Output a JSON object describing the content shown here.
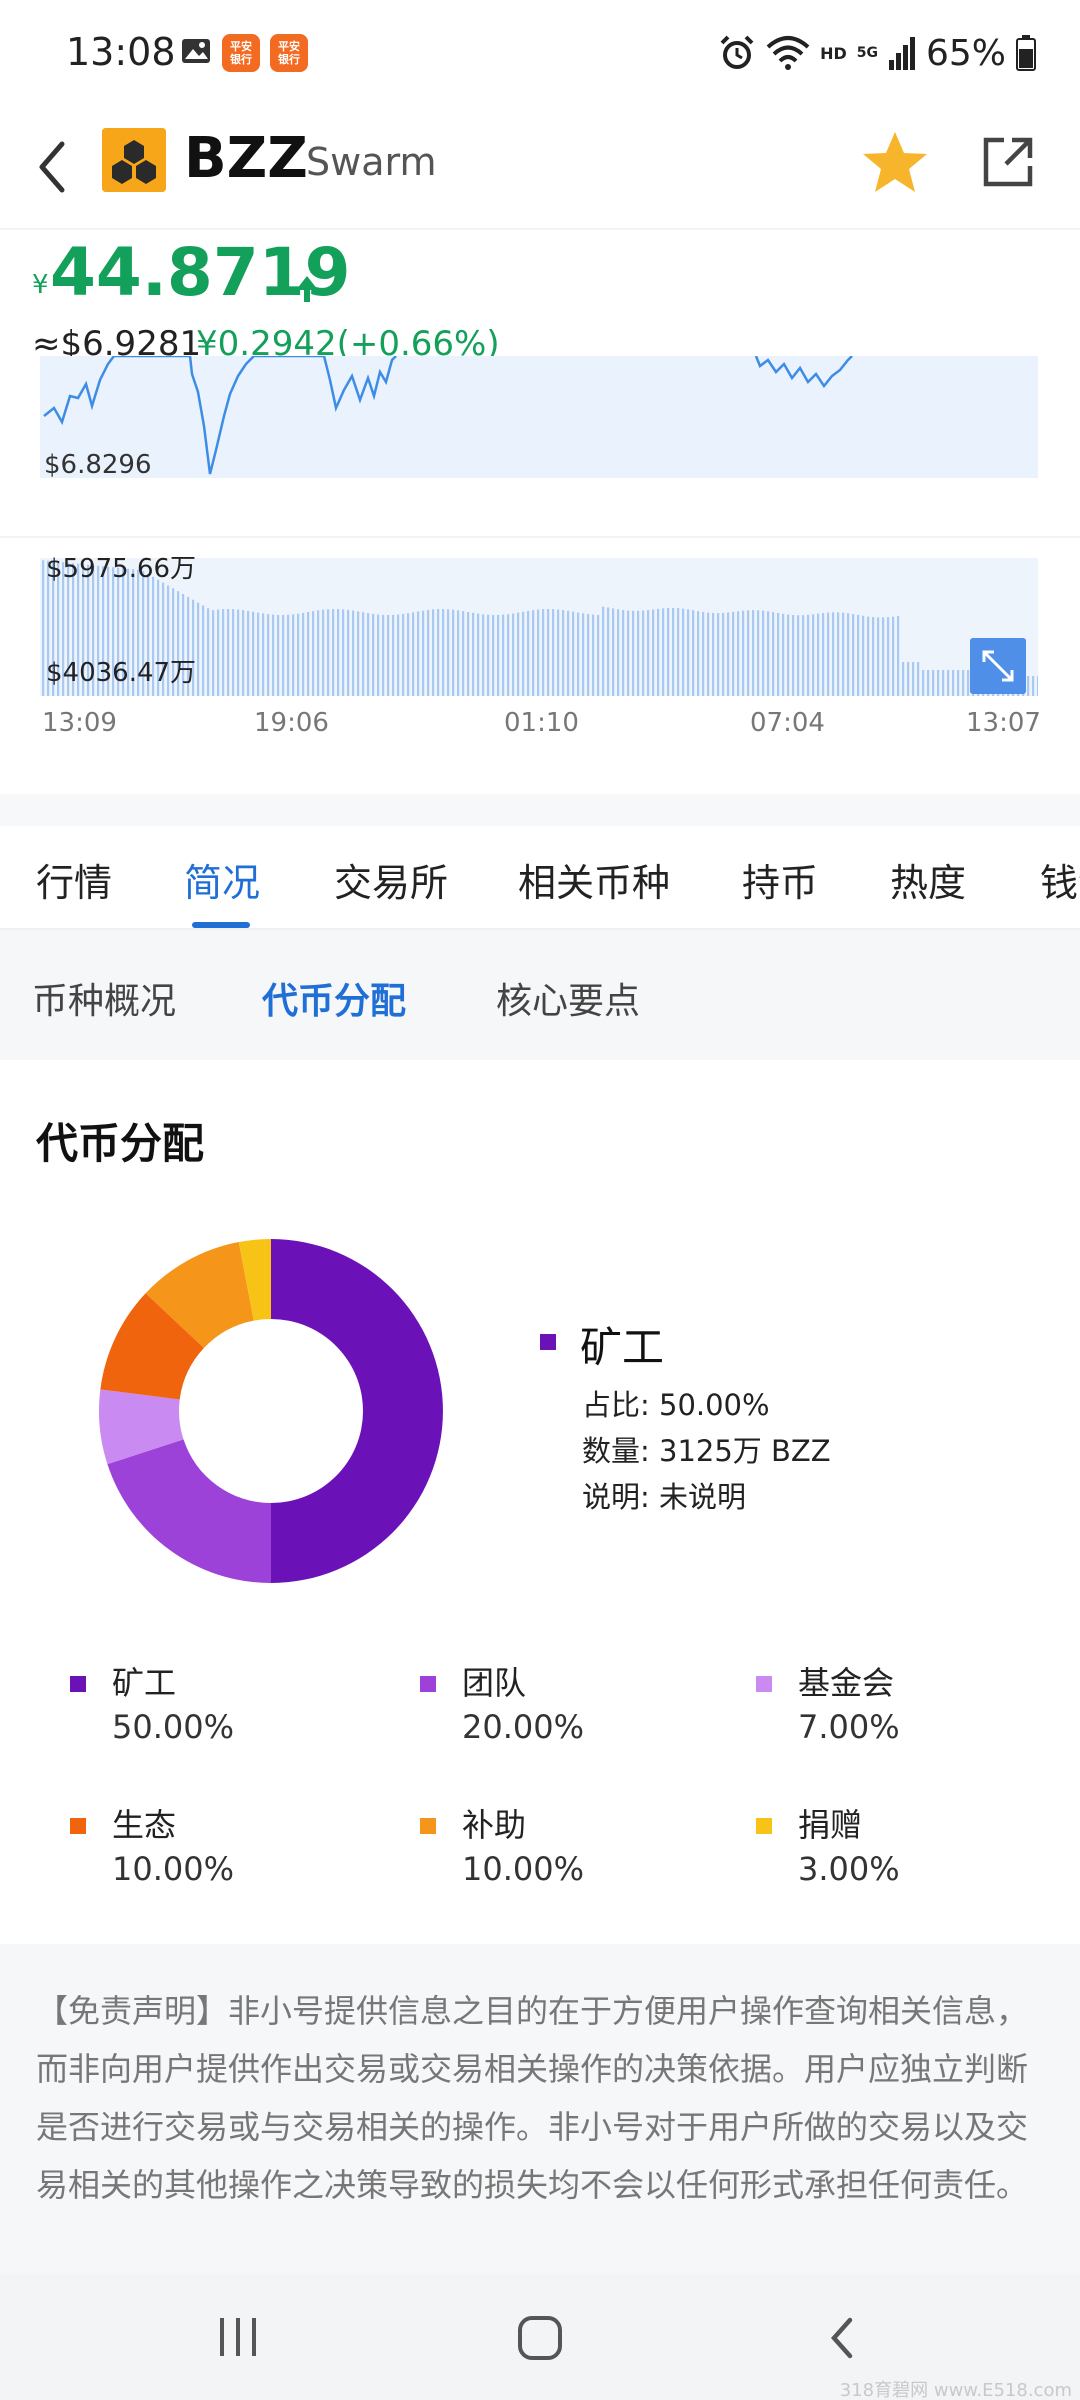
{
  "status_bar": {
    "time": "13:08",
    "app_badge_1": "平安\n银行",
    "app_badge_2": "平安\n银行",
    "hd": "HD",
    "network": "5G",
    "battery": "65%"
  },
  "header": {
    "symbol": "BZZ",
    "name": "Swarm",
    "icons": [
      "back-icon",
      "coin-logo",
      "star-icon",
      "share-icon"
    ],
    "star_color": "#f7b52c"
  },
  "price": {
    "currency_symbol": "¥",
    "value": "44.8719",
    "usd": "≈$6.9281",
    "change": "¥0.2942(+0.66%)",
    "up_color": "#12a05a"
  },
  "charts": {
    "price_low_label": "$6.8296",
    "volume_high_label": "$5975.66万",
    "volume_low_label": "$4036.47万",
    "time_labels": [
      "13:09",
      "19:06",
      "01:10",
      "07:04",
      "13:07"
    ]
  },
  "tabs": {
    "main": [
      "行情",
      "简况",
      "交易所",
      "相关币种",
      "持币",
      "热度",
      "钱包"
    ],
    "active_main": "简况",
    "sub": [
      "币种概况",
      "代币分配",
      "核心要点"
    ],
    "active_sub": "代币分配",
    "active_color": "#1f6fd6"
  },
  "distribution": {
    "title": "代币分配",
    "detail": {
      "name": "矿工",
      "ratio": "占比: 50.00%",
      "amount": "数量: 3125万 BZZ",
      "note": "说明: 未说明"
    },
    "legend": [
      {
        "name": "矿工",
        "value": "50.00%"
      },
      {
        "name": "团队",
        "value": "20.00%"
      },
      {
        "name": "基金会",
        "value": "7.00%"
      },
      {
        "name": "生态",
        "value": "10.00%"
      },
      {
        "name": "补助",
        "value": "10.00%"
      },
      {
        "name": "捐赠",
        "value": "3.00%"
      }
    ]
  },
  "chart_data": {
    "type": "pie",
    "categories": [
      "矿工",
      "团队",
      "基金会",
      "生态",
      "补助",
      "捐赠"
    ],
    "values": [
      50,
      20,
      7,
      10,
      10,
      3
    ],
    "colors": [
      "#6a11b8",
      "#9d42d8",
      "#c98af2",
      "#f0640e",
      "#f5951a",
      "#f7c316"
    ],
    "title": "代币分配",
    "donut": true
  },
  "disclaimer": "【免责声明】非小号提供信息之目的在于方便用户操作查询相关信息，而非向用户提供作出交易或交易相关操作的决策依据。用户应独立判断是否进行交易或与交易相关的操作。非小号对于用户所做的交易以及交易相关的其他操作之决策导致的损失均不会以任何形式承担任何责任。",
  "watermark": "318育碧网 www.E518.com"
}
